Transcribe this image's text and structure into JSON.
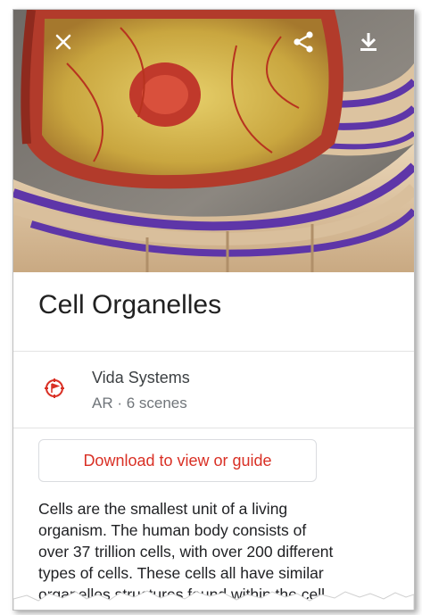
{
  "colors": {
    "accent": "#d93025",
    "title": "#212121",
    "secondary_text": "#70757a",
    "body_text": "#202124"
  },
  "header": {
    "close_icon": "close-icon",
    "share_icon": "share-icon",
    "download_icon": "download-icon"
  },
  "item": {
    "title": "Cell Organelles",
    "publisher": "Vida Systems",
    "meta": "AR · 6 scenes",
    "publisher_icon": "target-flag-icon"
  },
  "actions": {
    "download_label": "Download to view or guide"
  },
  "description": {
    "lines": [
      "Cells are the smallest unit of a living",
      "organism. The human body consists of",
      "over 37 trillion cells, with over 200 different",
      "types of cells. These cells all have similar",
      "organelles structures found within the cell"
    ]
  }
}
